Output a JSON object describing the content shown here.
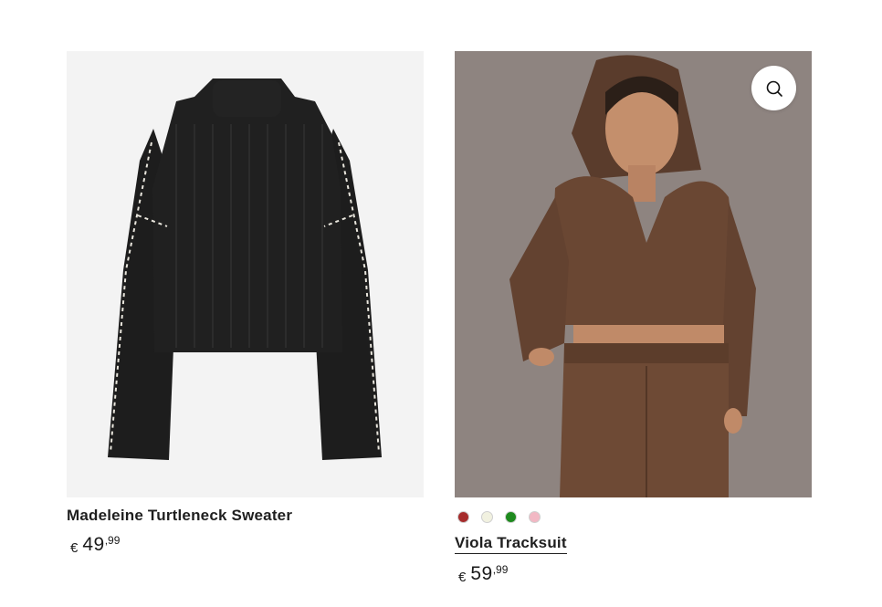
{
  "products": [
    {
      "title": "Madeleine Turtleneck Sweater",
      "price": {
        "currency": "€",
        "integer": "49",
        "decimal": ",99"
      },
      "image_alt": "black turtleneck sweater"
    },
    {
      "title": "Viola Tracksuit",
      "price": {
        "currency": "€",
        "integer": "59",
        "decimal": ",99"
      },
      "image_alt": "brown tracksuit model",
      "quick_view_icon": "search-icon",
      "swatches": [
        "#a62c2c",
        "#f1f1e0",
        "#1e8a1e",
        "#f2b8c4"
      ]
    }
  ]
}
